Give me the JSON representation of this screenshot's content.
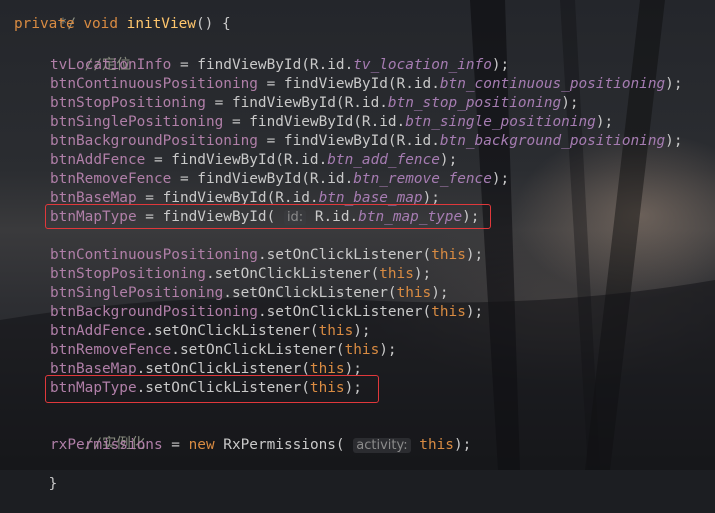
{
  "theme": {
    "keyword": "#d98b42",
    "method_decl": "#ffc66d",
    "field": "#b07fa8",
    "static_ref": "#a67cb2",
    "comment": "#8a8d80",
    "highlight_box": "#e0383b"
  },
  "code": {
    "l0": {
      "cmt": "*/"
    },
    "l1": {
      "kw1": "private",
      "kw2": "void",
      "fn": "initView",
      "rest": "() {"
    },
    "l2": {
      "cmt": "//定位"
    },
    "l3": {
      "field": "tvLocationInfo",
      "eq": " = findViewById(R.id.",
      "id": "tv_location_info",
      "end": ");"
    },
    "l4": {
      "field": "btnContinuousPositioning",
      "eq": " = findViewById(R.id.",
      "id": "btn_continuous_positioning",
      "end": ");"
    },
    "l5": {
      "field": "btnStopPositioning",
      "eq": " = findViewById(R.id.",
      "id": "btn_stop_positioning",
      "end": ");"
    },
    "l6": {
      "field": "btnSinglePositioning",
      "eq": " = findViewById(R.id.",
      "id": "btn_single_positioning",
      "end": ");"
    },
    "l7": {
      "field": "btnBackgroundPositioning",
      "eq": " = findViewById(R.id.",
      "id": "btn_background_positioning",
      "end": ");"
    },
    "l8": {
      "field": "btnAddFence",
      "eq": " = findViewById(R.id.",
      "id": "btn_add_fence",
      "end": ");"
    },
    "l9": {
      "field": "btnRemoveFence",
      "eq": " = findViewById(R.id.",
      "id": "btn_remove_fence",
      "end": ");"
    },
    "l10": {
      "field": "btnBaseMap",
      "eq": " = findViewById(R.id.",
      "id": "btn_base_map",
      "end": ");"
    },
    "l11": {
      "field": "btnMapType",
      "eq": " = findViewById( ",
      "hint": "id:",
      "rid": " R.id.",
      "id": "btn_map_type",
      "end": ");"
    },
    "l13": {
      "field": "btnContinuousPositioning",
      "call": ".setOnClickListener(",
      "this": "this",
      "end": ");"
    },
    "l14": {
      "field": "btnStopPositioning",
      "call": ".setOnClickListener(",
      "this": "this",
      "end": ");"
    },
    "l15": {
      "field": "btnSinglePositioning",
      "call": ".setOnClickListener(",
      "this": "this",
      "end": ");"
    },
    "l16": {
      "field": "btnBackgroundPositioning",
      "call": ".setOnClickListener(",
      "this": "this",
      "end": ");"
    },
    "l17": {
      "field": "btnAddFence",
      "call": ".setOnClickListener(",
      "this": "this",
      "end": ");"
    },
    "l18": {
      "field": "btnRemoveFence",
      "call": ".setOnClickListener(",
      "this": "this",
      "end": ");"
    },
    "l19": {
      "field": "btnBaseMap",
      "call": ".setOnClickListener(",
      "this": "this",
      "end": ");"
    },
    "l20": {
      "field": "btnMapType",
      "call": ".setOnClickListener(",
      "this": "this",
      "end": ");"
    },
    "l22": {
      "cmt": "//实例化"
    },
    "l23": {
      "field": "rxPermissions",
      "eq": " = ",
      "kw": "new",
      "cls": " RxPermissions( ",
      "hint": "activity:",
      "this": "this",
      "end": ");"
    },
    "l24": {
      "brace": "}"
    }
  }
}
